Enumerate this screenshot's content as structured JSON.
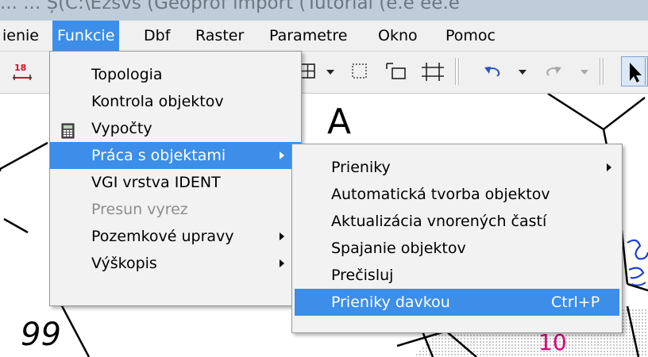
{
  "window": {
    "title_fragment": "...  ...       Ș(C:\\Ezsvs (Geoprof  import (Tutorial (e.e  ee.e"
  },
  "menubar": {
    "items": [
      {
        "label": "ienie"
      },
      {
        "label": "Funkcie"
      },
      {
        "label": "Dbf"
      },
      {
        "label": "Raster"
      },
      {
        "label": "Parametre"
      },
      {
        "label": "Okno"
      },
      {
        "label": "Pomoc"
      }
    ]
  },
  "toolbar": {
    "left_icon_text": "18",
    "icons": [
      "grid-select-icon",
      "dropdown-arrow-icon",
      "dotted-rect-icon",
      "corner-rect-icon",
      "crosshair-grid-icon",
      "undo-icon",
      "dropdown-arrow-icon",
      "redo-icon",
      "dropdown-arrow-icon",
      "pointer-arrow-icon"
    ]
  },
  "funkcie_menu": {
    "items": [
      {
        "label": "Topologia",
        "state": "normal",
        "submenu": false,
        "icon": ""
      },
      {
        "label": "Kontrola objektov",
        "state": "normal",
        "submenu": false,
        "icon": ""
      },
      {
        "label": "Vypočty",
        "state": "normal",
        "submenu": false,
        "icon": "calculator-icon"
      },
      {
        "label": "Práca s objektami",
        "state": "highlighted",
        "submenu": true,
        "icon": ""
      },
      {
        "label": "VGI vrstva IDENT",
        "state": "normal",
        "submenu": false,
        "icon": ""
      },
      {
        "label": "Presun vyrez",
        "state": "disabled",
        "submenu": false,
        "icon": ""
      },
      {
        "label": "Pozemkové upravy",
        "state": "normal",
        "submenu": true,
        "icon": ""
      },
      {
        "label": "Výškopis",
        "state": "normal",
        "submenu": true,
        "icon": ""
      }
    ]
  },
  "praca_submenu": {
    "items": [
      {
        "label": "Prieniky",
        "submenu": true,
        "shortcut": "",
        "state": "normal"
      },
      {
        "label": "Automatická tvorba objektov",
        "submenu": false,
        "shortcut": "",
        "state": "normal"
      },
      {
        "label": "Aktualizácia vnorených častí",
        "submenu": false,
        "shortcut": "",
        "state": "normal"
      },
      {
        "label": "Spajanie objektov",
        "submenu": false,
        "shortcut": "",
        "state": "normal"
      },
      {
        "label": "Prečisluj",
        "submenu": false,
        "shortcut": "",
        "state": "normal"
      },
      {
        "label": "Prieniky davkou",
        "submenu": false,
        "shortcut": "Ctrl+P",
        "state": "highlighted"
      }
    ]
  },
  "canvas": {
    "labels": [
      "A",
      "99",
      "10"
    ]
  },
  "colors": {
    "highlight": "#3c8ee8",
    "menu_bg": "#f2f2f2",
    "magenta_label": "#e0007a",
    "blue_sketch": "#1a3fd6"
  }
}
